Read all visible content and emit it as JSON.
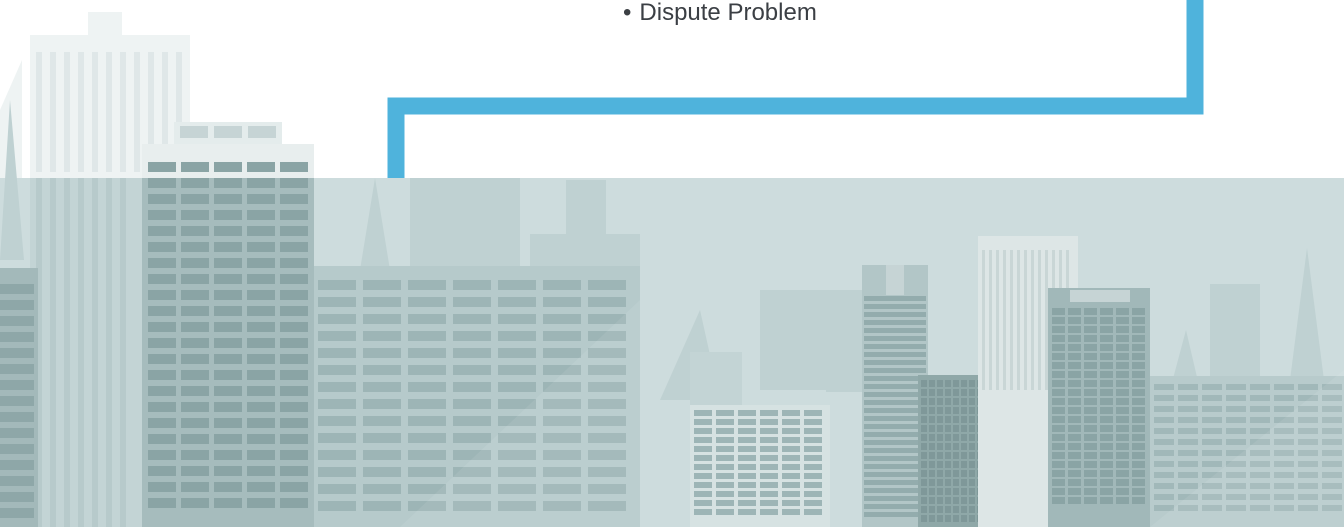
{
  "bullet_list": {
    "marker": "•",
    "items": [
      "Dispute Problem"
    ]
  },
  "colors": {
    "connector": "#4fb3dc",
    "text": "#3b3f44",
    "sky_band": "#cddcdd",
    "building_dark": "#8fa8a8",
    "building_mid": "#b4c7c7",
    "building_light": "#e4ecec",
    "window": "#aac1c1"
  },
  "icons": {
    "background": "city-skyline-illustration"
  }
}
